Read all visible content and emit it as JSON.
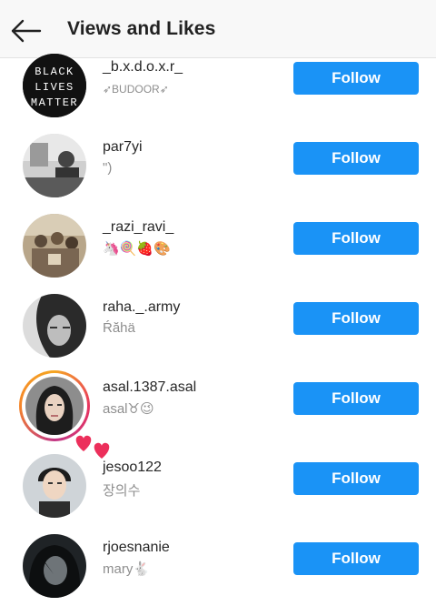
{
  "header": {
    "title": "Views and Likes",
    "back_icon": "arrow-left-icon"
  },
  "colors": {
    "follow_button": "#1a93f6",
    "username": "#262626",
    "subtitle": "#8e8e8e"
  },
  "viewers": [
    {
      "username": "_b.x.d.o.x.r_",
      "subtitle": "➶BUDOOR➶",
      "button": "Follow",
      "avatar_text": [
        "BLACK",
        "LIVES",
        "MATTER"
      ]
    },
    {
      "username": "par7yi",
      "subtitle": "\")",
      "button": "Follow"
    },
    {
      "username": "_razi_ravi_",
      "subtitle": "🦄🍭🍓🎨",
      "button": "Follow"
    },
    {
      "username": "raha._.army",
      "subtitle": "Ŕăhä",
      "button": "Follow"
    },
    {
      "username": "asal.1387.asal",
      "subtitle": "asal♉😉",
      "button": "Follow",
      "has_story": true,
      "liked": true
    },
    {
      "username": "jesoo122",
      "subtitle": "장의수",
      "button": "Follow"
    },
    {
      "username": "rjoesnanie",
      "subtitle": "mary🐇",
      "button": "Follow"
    }
  ]
}
